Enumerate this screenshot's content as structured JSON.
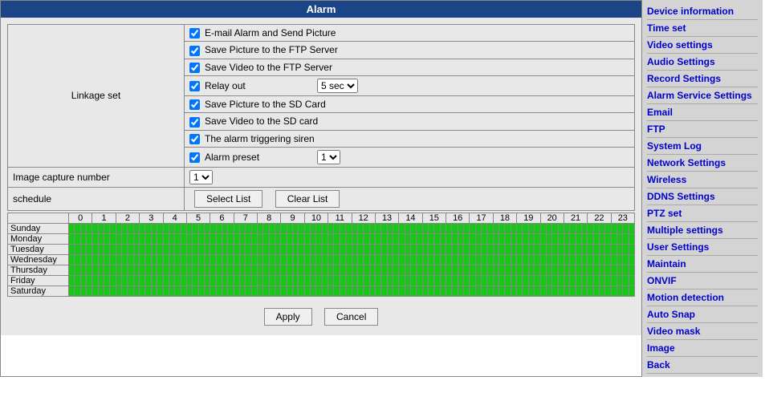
{
  "header": {
    "title": "Alarm"
  },
  "linkage": {
    "section_label": "Linkage set",
    "options": [
      {
        "label": "E-mail Alarm and Send Picture",
        "checked": true
      },
      {
        "label": "Save Picture to the FTP Server",
        "checked": true
      },
      {
        "label": "Save Video to the FTP Server",
        "checked": true
      },
      {
        "label": "Relay out",
        "checked": true,
        "select": "5 sec"
      },
      {
        "label": "Save Picture to the SD Card",
        "checked": true
      },
      {
        "label": "Save Video to the SD card",
        "checked": true
      },
      {
        "label": "The alarm triggering siren",
        "checked": true
      },
      {
        "label": "Alarm preset",
        "checked": true,
        "select": "1"
      }
    ]
  },
  "image_capture": {
    "label": "Image capture number",
    "value": "1"
  },
  "schedule": {
    "label": "schedule",
    "buttons": {
      "select": "Select List",
      "clear": "Clear List"
    },
    "hours": [
      "0",
      "1",
      "2",
      "3",
      "4",
      "5",
      "6",
      "7",
      "8",
      "9",
      "10",
      "11",
      "12",
      "13",
      "14",
      "15",
      "16",
      "17",
      "18",
      "19",
      "20",
      "21",
      "22",
      "23"
    ],
    "days": [
      "Sunday",
      "Monday",
      "Tuesday",
      "Wednesday",
      "Thursday",
      "Friday",
      "Saturday"
    ]
  },
  "footer": {
    "apply": "Apply",
    "cancel": "Cancel"
  },
  "sidebar": {
    "links": [
      "Device information",
      "Time set",
      "Video settings",
      "Audio Settings",
      "Record Settings",
      "Alarm Service Settings",
      "Email",
      "FTP",
      "System Log",
      "Network Settings",
      "Wireless",
      "DDNS Settings",
      "PTZ set",
      "Multiple settings",
      "User Settings",
      "Maintain",
      "ONVIF",
      "Motion detection",
      "Auto Snap",
      "Video mask",
      "Image",
      "Back"
    ]
  }
}
